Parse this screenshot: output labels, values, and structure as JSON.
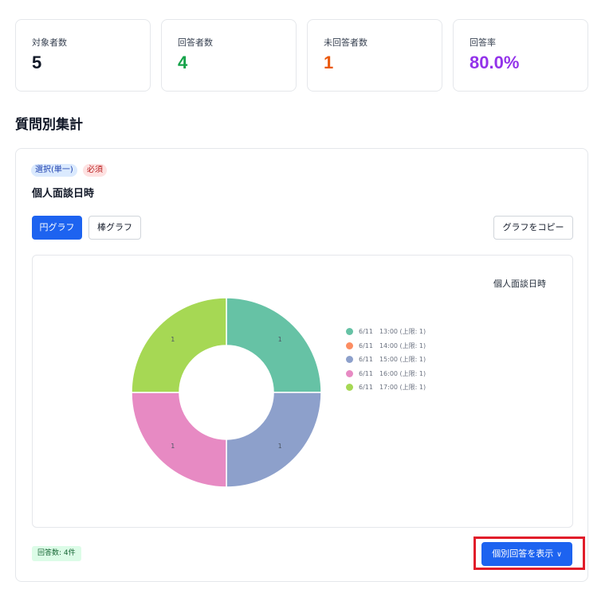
{
  "stats": [
    {
      "label": "対象者数",
      "value": "5",
      "color": "#111827"
    },
    {
      "label": "回答者数",
      "value": "4",
      "color": "#16a34a"
    },
    {
      "label": "未回答者数",
      "value": "1",
      "color": "#ea580c"
    },
    {
      "label": "回答率",
      "value": "80.0%",
      "color": "#9333ea"
    }
  ],
  "section_title": "質問別集計",
  "question": {
    "type_badge": "選択(単一)",
    "required_badge": "必須",
    "title": "個人面談日時",
    "buttons": {
      "pie": "円グラフ",
      "bar": "棒グラフ",
      "copy": "グラフをコピー"
    },
    "response_count": "回答数: 4件",
    "show_responses": "個別回答を表示",
    "show_icon": "chevron-down-icon"
  },
  "chart_data": {
    "type": "pie",
    "title": "個人面談日時",
    "categories": [
      "6/11　13:00 (上限: 1)",
      "6/11　14:00 (上限: 1)",
      "6/11　15:00 (上限: 1)",
      "6/11　16:00 (上限: 1)",
      "6/11　17:00 (上限: 1)"
    ],
    "values": [
      1,
      0,
      1,
      1,
      1
    ],
    "colors": [
      "#66c2a5",
      "#fc8d62",
      "#8da0cb",
      "#e78ac3",
      "#a6d854"
    ],
    "data_labels": [
      "1",
      "",
      "1",
      "1",
      "1"
    ],
    "donut": true,
    "legend_position": "right"
  }
}
